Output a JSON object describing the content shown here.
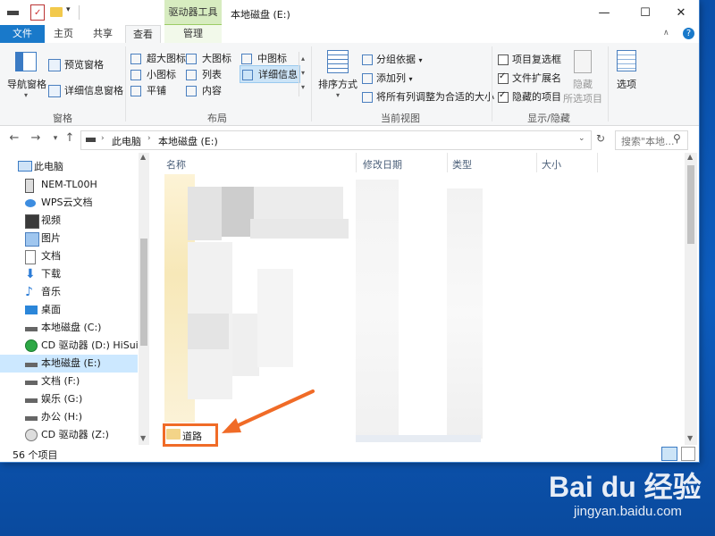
{
  "window": {
    "title": "本地磁盘 (E:)",
    "context_tab": "驱动器工具",
    "controls": [
      "—",
      "☐",
      "✕"
    ]
  },
  "ribbon_tabs": [
    "文件",
    "主页",
    "共享",
    "查看",
    "管理"
  ],
  "ribbon": {
    "panes": {
      "nav_pane": "导航窗格",
      "preview_pane": "预览窗格",
      "details_pane": "详细信息窗格",
      "group_label": "窗格"
    },
    "layout": {
      "items": [
        "超大图标",
        "大图标",
        "中图标",
        "小图标",
        "列表",
        "详细信息",
        "平铺",
        "内容"
      ],
      "group_label": "布局"
    },
    "current_view": {
      "sort_by": "排序方式",
      "group_by": "分组依据",
      "add_columns": "添加列",
      "fit_columns": "将所有列调整为合适的大小",
      "group_label": "当前视图"
    },
    "show_hide": {
      "item_checkboxes": "项目复选框",
      "file_extensions": "文件扩展名",
      "hidden_items": "隐藏的项目",
      "hide_selected_1": "隐藏",
      "hide_selected_2": "所选项目",
      "group_label": "显示/隐藏"
    },
    "options": "选项"
  },
  "address": {
    "path": [
      "此电脑",
      "本地磁盘 (E:)"
    ],
    "search_placeholder": "搜索\"本地..."
  },
  "nav_pane": {
    "items": [
      {
        "label": "此电脑",
        "icon": "computer-icon"
      },
      {
        "label": "NEM-TL00H",
        "icon": "phone-icon"
      },
      {
        "label": "WPS云文档",
        "icon": "cloud-icon"
      },
      {
        "label": "视频",
        "icon": "video-icon"
      },
      {
        "label": "图片",
        "icon": "pictures-icon"
      },
      {
        "label": "文档",
        "icon": "documents-icon"
      },
      {
        "label": "下载",
        "icon": "download-icon"
      },
      {
        "label": "音乐",
        "icon": "music-icon"
      },
      {
        "label": "桌面",
        "icon": "desktop-icon"
      },
      {
        "label": "本地磁盘 (C:)",
        "icon": "drive-icon"
      },
      {
        "label": "CD 驱动器 (D:) HiSuite",
        "icon": "cd-icon"
      },
      {
        "label": "本地磁盘 (E:)",
        "icon": "drive-icon"
      },
      {
        "label": "文档 (F:)",
        "icon": "drive-icon"
      },
      {
        "label": "娱乐 (G:)",
        "icon": "drive-icon"
      },
      {
        "label": "办公 (H:)",
        "icon": "drive-icon"
      },
      {
        "label": "CD 驱动器 (Z:)",
        "icon": "cd-icon"
      }
    ],
    "selected_index": 11
  },
  "columns": [
    "名称",
    "修改日期",
    "类型",
    "大小"
  ],
  "highlighted_folder": "道路",
  "status": {
    "count": "56 个项目"
  },
  "watermark": {
    "brand": "Bai du 经验",
    "url": "jingyan.baidu.com"
  },
  "colors": {
    "accent": "#1979ca",
    "highlight": "#f06b27",
    "selection": "#cce8ff"
  }
}
